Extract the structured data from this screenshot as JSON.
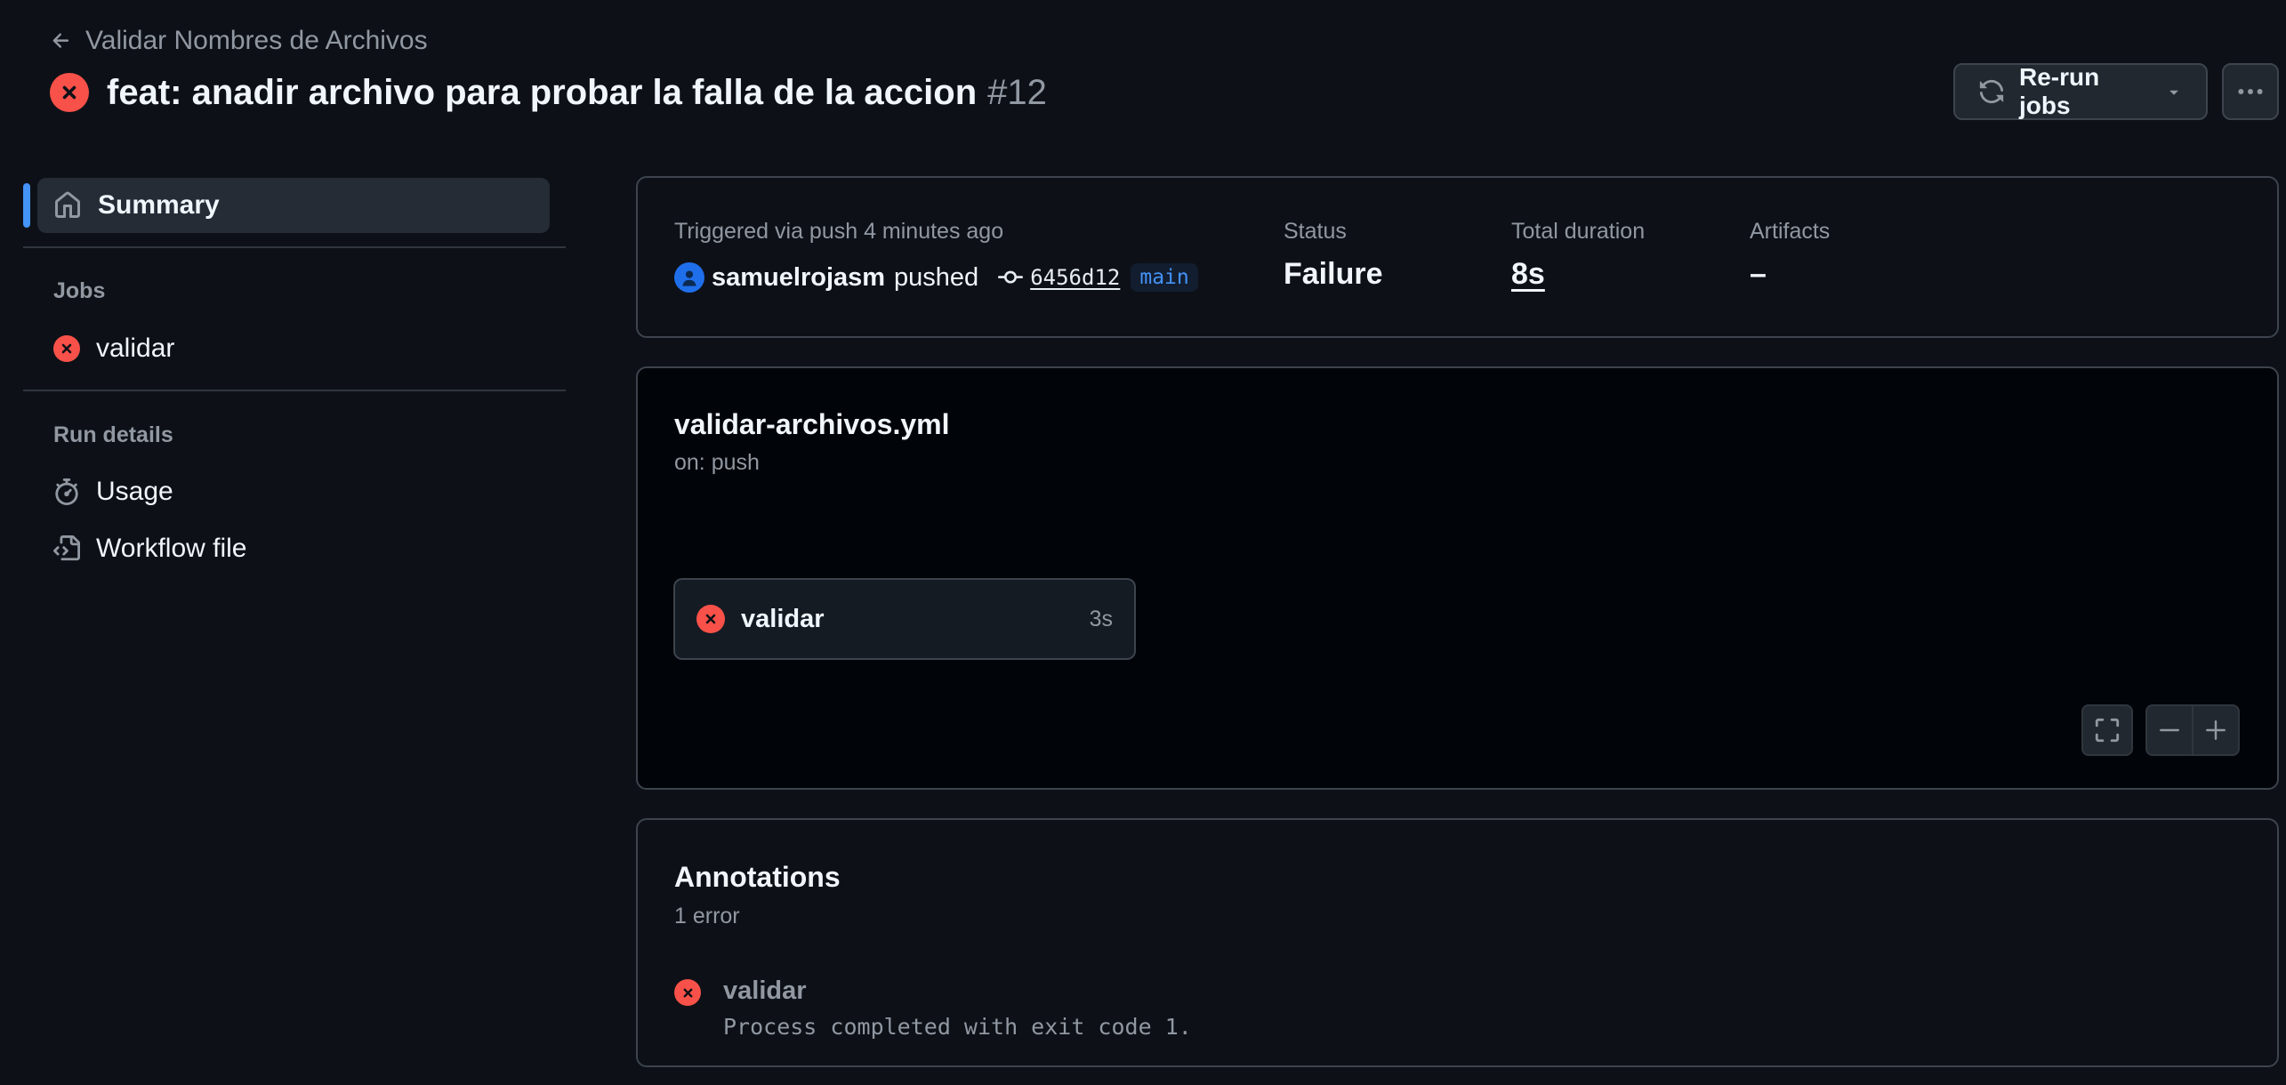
{
  "header": {
    "back_label": "Validar Nombres de Archivos",
    "title": "feat: anadir archivo para probar la falla de la accion",
    "run_number": "#12",
    "rerun_label": "Re-run jobs"
  },
  "sidebar": {
    "summary_label": "Summary",
    "jobs_heading": "Jobs",
    "jobs": [
      {
        "label": "validar",
        "status": "failure"
      }
    ],
    "run_details_heading": "Run details",
    "details": [
      {
        "label": "Usage",
        "icon": "stopwatch-icon"
      },
      {
        "label": "Workflow file",
        "icon": "file-code-icon"
      }
    ]
  },
  "summary": {
    "trigger_text": "Triggered via push 4 minutes ago",
    "actor": "samuelrojasm",
    "action": "pushed",
    "commit": "6456d12",
    "branch": "main",
    "status_label": "Status",
    "status_value": "Failure",
    "duration_label": "Total duration",
    "duration_value": "8s",
    "artifacts_label": "Artifacts",
    "artifacts_value": "–"
  },
  "workflow": {
    "file_name": "validar-archivos.yml",
    "trigger": "on: push",
    "job": {
      "name": "validar",
      "duration": "3s",
      "status": "failure"
    }
  },
  "annotations": {
    "title": "Annotations",
    "count_text": "1 error",
    "items": [
      {
        "job": "validar",
        "message": "Process completed with exit code 1."
      }
    ]
  },
  "colors": {
    "background": "#0d1117",
    "failure": "#f85149",
    "accent": "#4493f8",
    "border": "#3d444d"
  }
}
